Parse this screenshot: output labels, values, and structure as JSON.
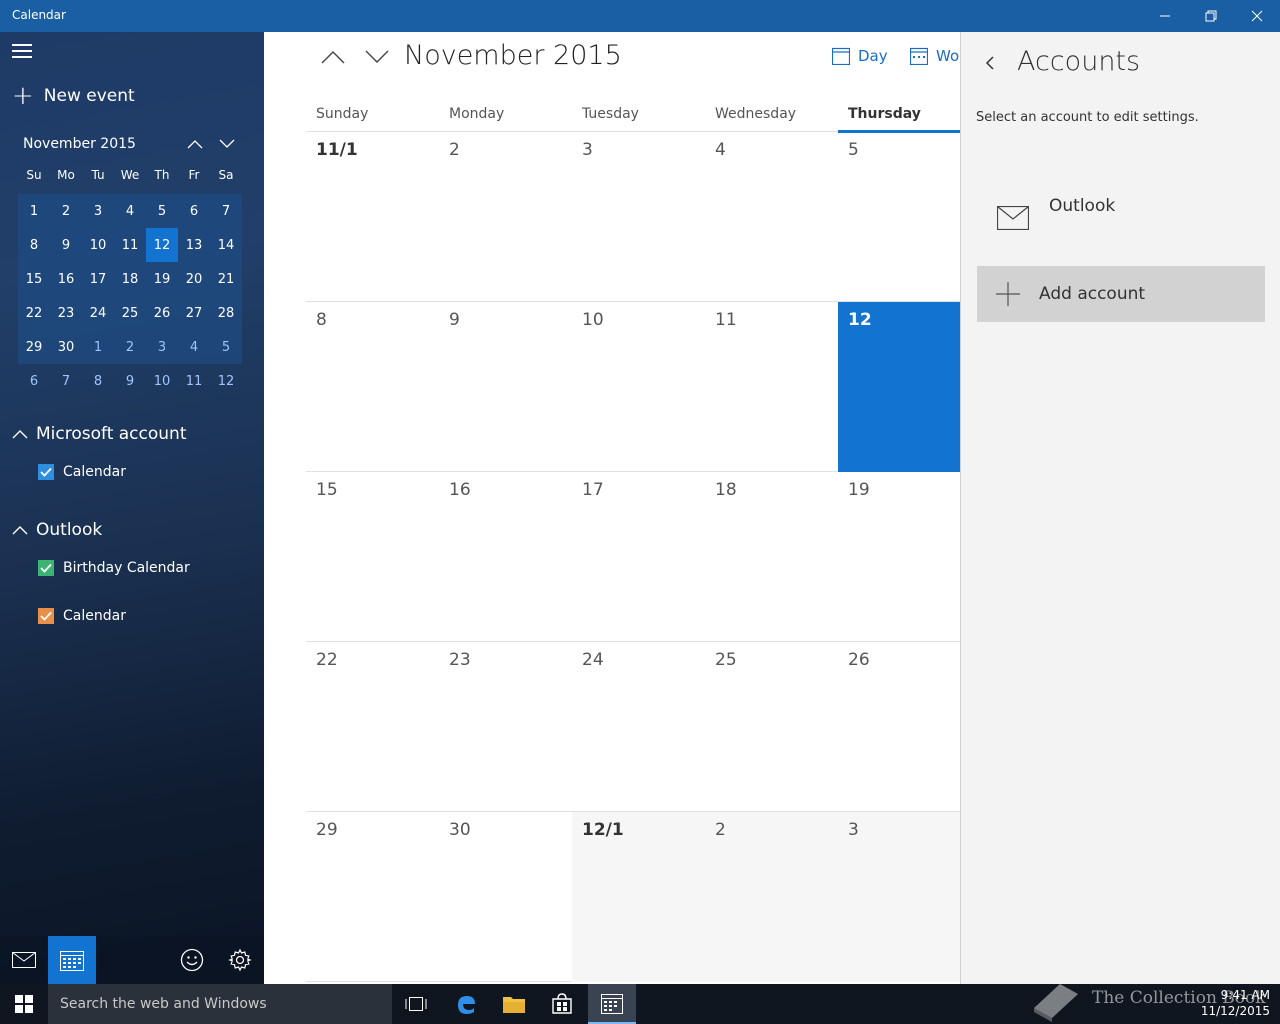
{
  "window": {
    "title": "Calendar",
    "minimize_icon": "minimize-icon",
    "maximize_icon": "restore-icon",
    "close_icon": "close-icon"
  },
  "sidebar": {
    "new_event_label": "New event",
    "mini_calendar": {
      "month_label": "November 2015",
      "days_of_week": [
        "Su",
        "Mo",
        "Tu",
        "We",
        "Th",
        "Fr",
        "Sa"
      ],
      "weeks": [
        [
          "1",
          "2",
          "3",
          "4",
          "5",
          "6",
          "7"
        ],
        [
          "8",
          "9",
          "10",
          "11",
          "12",
          "13",
          "14"
        ],
        [
          "15",
          "16",
          "17",
          "18",
          "19",
          "20",
          "21"
        ],
        [
          "22",
          "23",
          "24",
          "25",
          "26",
          "27",
          "28"
        ],
        [
          "29",
          "30",
          "1",
          "2",
          "3",
          "4",
          "5"
        ],
        [
          "6",
          "7",
          "8",
          "9",
          "10",
          "11",
          "12"
        ]
      ],
      "today": "12"
    },
    "groups": [
      {
        "name": "Microsoft account",
        "calendars": [
          {
            "label": "Calendar",
            "color": "#2e8ee0",
            "checked": true
          }
        ]
      },
      {
        "name": "Outlook",
        "calendars": [
          {
            "label": "Birthday Calendar",
            "color": "#3cb371",
            "checked": true
          },
          {
            "label": "Calendar",
            "color": "#e8904a",
            "checked": true
          }
        ]
      }
    ]
  },
  "main": {
    "month_title": "November 2015",
    "views": [
      {
        "label": "Day",
        "icon": "calendar-day-icon"
      },
      {
        "label": "Wor",
        "icon": "calendar-week-icon"
      }
    ],
    "days_of_week": [
      "Sunday",
      "Monday",
      "Tuesday",
      "Wednesday",
      "Thursday"
    ],
    "weeks": [
      [
        "11/1",
        "2",
        "3",
        "4",
        "5"
      ],
      [
        "8",
        "9",
        "10",
        "11",
        "12"
      ],
      [
        "15",
        "16",
        "17",
        "18",
        "19"
      ],
      [
        "22",
        "23",
        "24",
        "25",
        "26"
      ],
      [
        "29",
        "30",
        "12/1",
        "2",
        "3"
      ]
    ]
  },
  "accounts_panel": {
    "title": "Accounts",
    "hint": "Select an account to edit settings.",
    "accounts": [
      {
        "name": "Outlook",
        "icon": "mail-icon"
      }
    ],
    "add_account_label": "Add account"
  },
  "taskbar": {
    "search_placeholder": "Search the web and Windows",
    "time": "9:41 AM",
    "date": "11/12/2015",
    "watermark": "The Collection Book"
  },
  "colors": {
    "accent": "#1273d1",
    "titlebar": "#1a5fa3",
    "link": "#1a6dc7"
  }
}
